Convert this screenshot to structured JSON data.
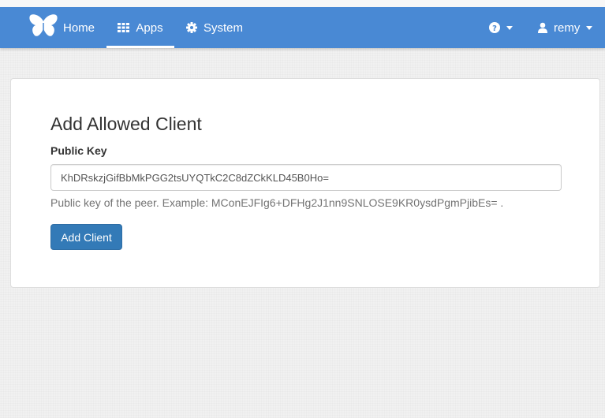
{
  "navbar": {
    "logo_icon": "butterfly-icon",
    "items": [
      {
        "label": "Home",
        "icon": "",
        "active": false
      },
      {
        "label": "Apps",
        "icon": "grid-icon",
        "active": true
      },
      {
        "label": "System",
        "icon": "gear-icon",
        "active": false
      }
    ],
    "help_icon": "question-circle-icon",
    "user": {
      "label": "remy",
      "icon": "user-icon"
    },
    "background_color": "#4989d4"
  },
  "form": {
    "title": "Add Allowed Client",
    "public_key_label": "Public Key",
    "public_key_value": "KhDRskzjGifBbMkPGG2tsUYQTkC2C8dZCkKLD45B0Ho=",
    "help_text": "Public key of the peer. Example: MConEJFIg6+DFHg2J1nn9SNLOSE9KR0ysdPgmPjibEs= .",
    "submit_label": "Add Client",
    "button_color": "#337ab7"
  }
}
